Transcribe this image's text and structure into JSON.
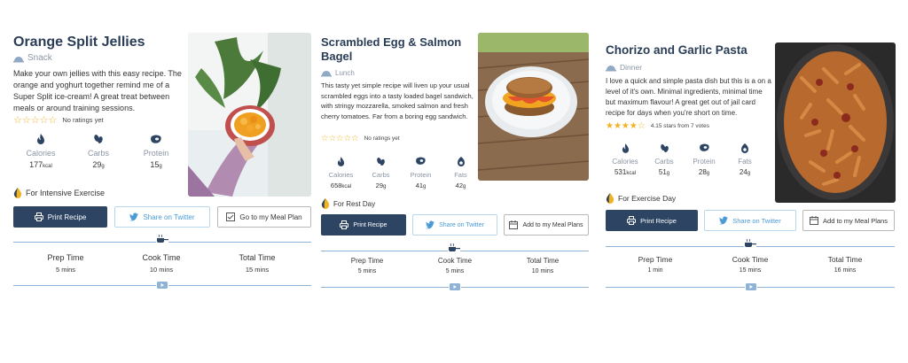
{
  "cards": [
    {
      "title": "Orange Split Jellies",
      "meal_type": "Snack",
      "description": "Make your own jellies with this easy recipe. The orange and yoghurt together remind me of a Super Split ice-cream! A great treat between meals or around training sessions.",
      "rating_text": "No ratings yet",
      "stars_filled": 0,
      "macros": [
        {
          "label": "Calories",
          "value": "177",
          "unit": "kcal",
          "icon": "flame-icon"
        },
        {
          "label": "Carbs",
          "value": "29",
          "unit": "g",
          "icon": "grains-icon"
        },
        {
          "label": "Protein",
          "value": "15",
          "unit": "g",
          "icon": "steak-icon"
        }
      ],
      "tag": "For Intensive Exercise",
      "buttons": {
        "print": "Print Recipe",
        "twitter": "Share on Twitter",
        "plan": "Go to my Meal Plan"
      },
      "times": [
        {
          "label": "Prep Time",
          "value": "5 mins"
        },
        {
          "label": "Cook Time",
          "value": "10 mins"
        },
        {
          "label": "Total Time",
          "value": "15 mins"
        }
      ]
    },
    {
      "title": "Scrambled Egg & Salmon Bagel",
      "meal_type": "Lunch",
      "description": "This tasty yet simple recipe will liven up your usual scrambled eggs into a tasty loaded bagel sandwich, with stringy mozzarella, smoked salmon and fresh cherry tomatoes. Far from a boring egg sandwich.",
      "rating_text": "No ratings yet",
      "stars_filled": 0,
      "macros": [
        {
          "label": "Calories",
          "value": "658",
          "unit": "kcal",
          "icon": "flame-icon"
        },
        {
          "label": "Carbs",
          "value": "29",
          "unit": "g",
          "icon": "grains-icon"
        },
        {
          "label": "Protein",
          "value": "41",
          "unit": "g",
          "icon": "steak-icon"
        },
        {
          "label": "Fats",
          "value": "42",
          "unit": "g",
          "icon": "avocado-icon"
        }
      ],
      "tag": "For Rest Day",
      "buttons": {
        "print": "Print Recipe",
        "twitter": "Share on Twitter",
        "plan": "Add to my Meal Plans"
      },
      "times": [
        {
          "label": "Prep Time",
          "value": "5 mins"
        },
        {
          "label": "Cook Time",
          "value": "5 mins"
        },
        {
          "label": "Total Time",
          "value": "10 mins"
        }
      ]
    },
    {
      "title": "Chorizo and Garlic Pasta",
      "meal_type": "Dinner",
      "description": "I love a quick and simple pasta dish but this is a on a level of it's own. Minimal ingredients, minimal time but maximum flavour! A great get out of jail card recipe for days when you're short on time.",
      "rating_text": "4.15 stars from 7 votes",
      "stars_filled": 4,
      "macros": [
        {
          "label": "Calories",
          "value": "531",
          "unit": "kcal",
          "icon": "flame-icon"
        },
        {
          "label": "Carbs",
          "value": "51",
          "unit": "g",
          "icon": "grains-icon"
        },
        {
          "label": "Protein",
          "value": "28",
          "unit": "g",
          "icon": "steak-icon"
        },
        {
          "label": "Fats",
          "value": "24",
          "unit": "g",
          "icon": "avocado-icon"
        }
      ],
      "tag": "For Exercise Day",
      "buttons": {
        "print": "Print Recipe",
        "twitter": "Share on Twitter",
        "plan": "Add to my Meal Plans"
      },
      "times": [
        {
          "label": "Prep Time",
          "value": "1 min"
        },
        {
          "label": "Cook Time",
          "value": "15 mins"
        },
        {
          "label": "Total Time",
          "value": "16 mins"
        }
      ]
    }
  ]
}
